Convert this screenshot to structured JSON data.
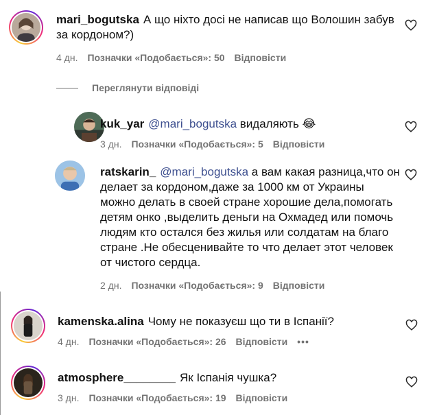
{
  "comments": [
    {
      "username": "mari_bogutska",
      "text": "А що ніхто досі не написав що Волошин забув за кордоном?)",
      "time": "4 дн.",
      "likes": "Позначки «Подобається»: 50",
      "reply": "Відповісти"
    },
    {
      "username": "kamenska.alina",
      "text": "Чому не показуєш що ти в Іспанії?",
      "time": "4 дн.",
      "likes": "Позначки «Подобається»: 26",
      "reply": "Відповісти",
      "more": "•••"
    },
    {
      "username": "atmosphere________",
      "text": "Як Іспанія чушка?",
      "time": "3 дн.",
      "likes": "Позначки «Подобається»: 19",
      "reply": "Відповісти"
    }
  ],
  "view_replies": "Переглянути відповіді",
  "replies": [
    {
      "username": "kuk_yar",
      "mention": "@mari_bogutska",
      "text": "видаляють 😂",
      "time": "3 дн.",
      "likes": "Позначки «Подобається»: 5",
      "reply": "Відповісти"
    },
    {
      "username": "ratskarin_",
      "mention": "@mari_bogutska",
      "text": "а вам какая разница,что он делает за кордоном,даже за 1000 км от Украины можно делать в своей стране хорошие дела,помогать детям онко ,выделить деньги на Охмадед или помочь людям кто остался без жилья или солдатам на благо стране .Не обесценивайте то что делает этот человек от чистого сердца.",
      "time": "2 дн.",
      "likes": "Позначки «Подобається»: 9",
      "reply": "Відповісти"
    }
  ],
  "icons": {
    "like": "heart-icon"
  },
  "colors": {
    "mention": "#3d4f8f",
    "meta": "#737373"
  }
}
